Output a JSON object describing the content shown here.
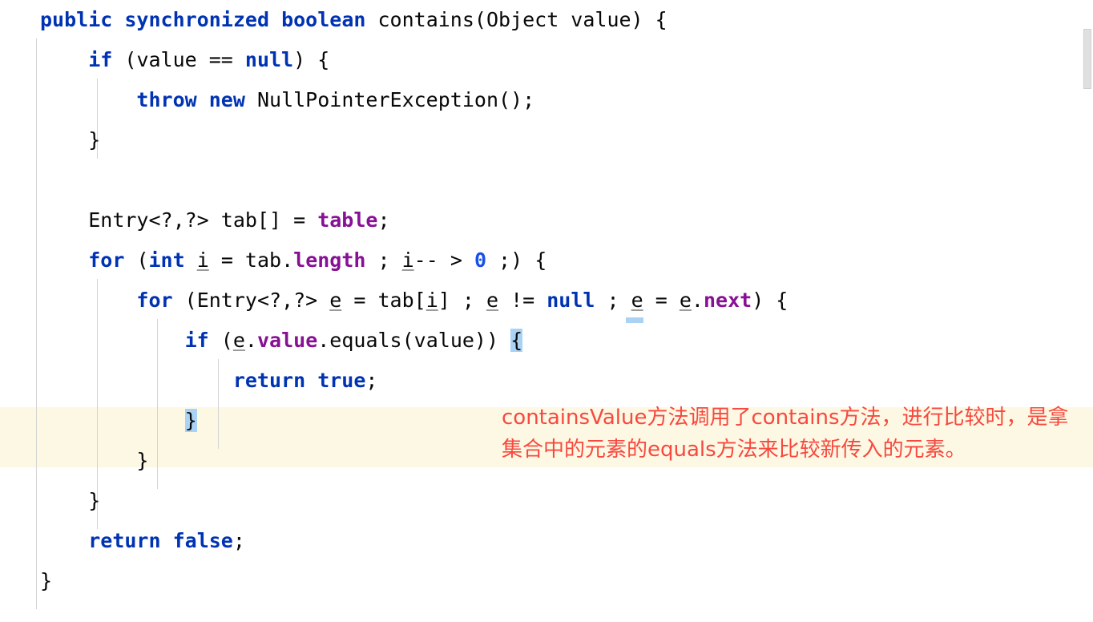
{
  "editor": {
    "language": "java",
    "font_size_px": 25,
    "line_height_px": 50,
    "colors": {
      "background": "#ffffff",
      "foreground": "#080808",
      "keyword": "#0033b3",
      "field": "#871094",
      "number": "#1750eb",
      "current_line": "#fdf8e3",
      "brace_match": "#a9d2f5",
      "indent_guide": "#d4d4d4",
      "annotation": "#f8483f",
      "scrollbar_thumb": "#e0e0e0"
    }
  },
  "code": {
    "lines": [
      "public synchronized boolean contains(Object value) {",
      "    if (value == null) {",
      "        throw new NullPointerException();",
      "    }",
      "",
      "    Entry<?,?> tab[] = table;",
      "    for (int i = tab.length ; i-- > 0 ;) {",
      "        for (Entry<?,?> e = tab[i] ; e != null ; e = e.next) {",
      "            if (e.value.equals(value)) {",
      "                return true;",
      "            }",
      "        }",
      "    }",
      "    return false;",
      "}"
    ],
    "keywords": [
      "public",
      "synchronized",
      "boolean",
      "if",
      "null",
      "throw",
      "new",
      "for",
      "int",
      "return",
      "true",
      "false"
    ],
    "fields": [
      "table",
      "length",
      "next",
      "value"
    ],
    "numbers": [
      "0"
    ],
    "local_variables": [
      "i",
      "e"
    ]
  },
  "annotation": {
    "line1": "containsValue方法调用了contains方法，进行比较时，是拿",
    "line2": "集合中的元素的equals方法来比较新传入的元素。"
  },
  "highlights": {
    "brace_open": "{",
    "brace_close": "}",
    "current_line_index": 10
  },
  "scrollbar": {
    "orientation": "vertical"
  }
}
